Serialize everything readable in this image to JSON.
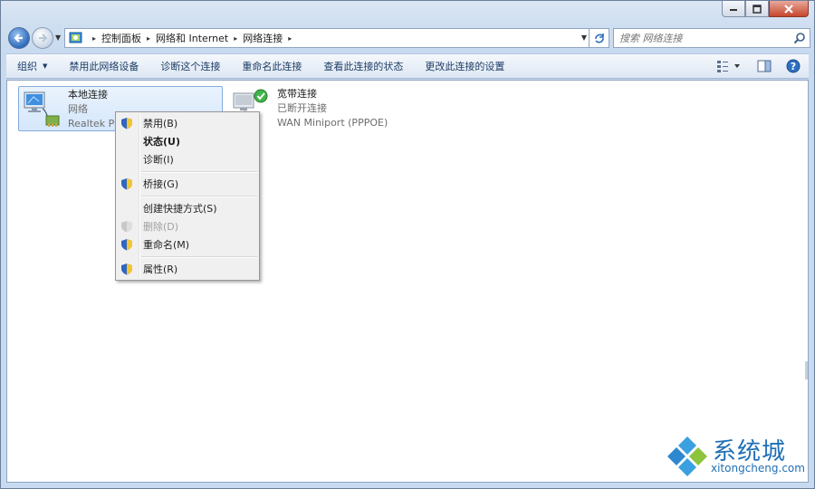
{
  "window": {
    "caption": {
      "minimize": "─",
      "maximize": "□",
      "close": "✕"
    }
  },
  "address": {
    "breadcrumbs": [
      "控制面板",
      "网络和 Internet",
      "网络连接"
    ],
    "separator": "▸"
  },
  "search": {
    "placeholder": "搜索 网络连接"
  },
  "toolbar": {
    "organize": "组织",
    "items": [
      "禁用此网络设备",
      "诊断这个连接",
      "重命名此连接",
      "查看此连接的状态",
      "更改此连接的设置"
    ]
  },
  "connections": [
    {
      "name": "本地连接",
      "status": "网络",
      "device": "Realtek PCIe GBE Family Controller"
    },
    {
      "name": "宽带连接",
      "status": "已断开连接",
      "device": "WAN Miniport (PPPOE)"
    }
  ],
  "context_menu": {
    "items": [
      {
        "label": "禁用(B)"
      },
      {
        "label": "状态(U)"
      },
      {
        "label": "诊断(I)"
      },
      {
        "label": "桥接(G)"
      },
      {
        "label": "创建快捷方式(S)"
      },
      {
        "label": "删除(D)"
      },
      {
        "label": "重命名(M)"
      },
      {
        "label": "属性(R)"
      }
    ]
  },
  "watermark": {
    "name": "系统城",
    "url": "xitongcheng.com"
  },
  "colors": {
    "accent": "#1f6fb5",
    "selection": "#d5e7fb",
    "menu_bg": "#f0f0f0"
  }
}
